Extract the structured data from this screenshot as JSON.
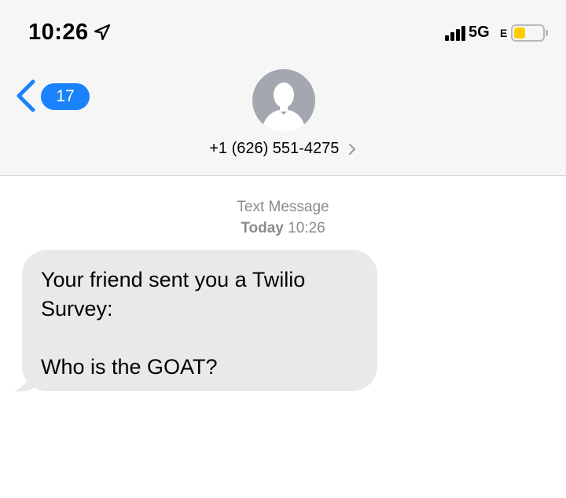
{
  "status_bar": {
    "time": "10:26",
    "network": "5G",
    "network_suffix": "E",
    "battery_color": "#ffcc00"
  },
  "nav": {
    "back_badge": "17",
    "contact_number": "+1 (626) 551-4275"
  },
  "conversation": {
    "service_label": "Text Message",
    "day_label": "Today",
    "time_label": "10:26",
    "messages": [
      {
        "direction": "incoming",
        "text": "Your friend sent you a Twilio\nSurvey:\n\nWho is the GOAT?"
      }
    ]
  },
  "colors": {
    "accent": "#1a82fb",
    "bubble_incoming": "#e9e9eb",
    "header_bg": "#f6f6f7",
    "meta_text": "#8a8a8e",
    "avatar_bg": "#a3a7b0"
  }
}
